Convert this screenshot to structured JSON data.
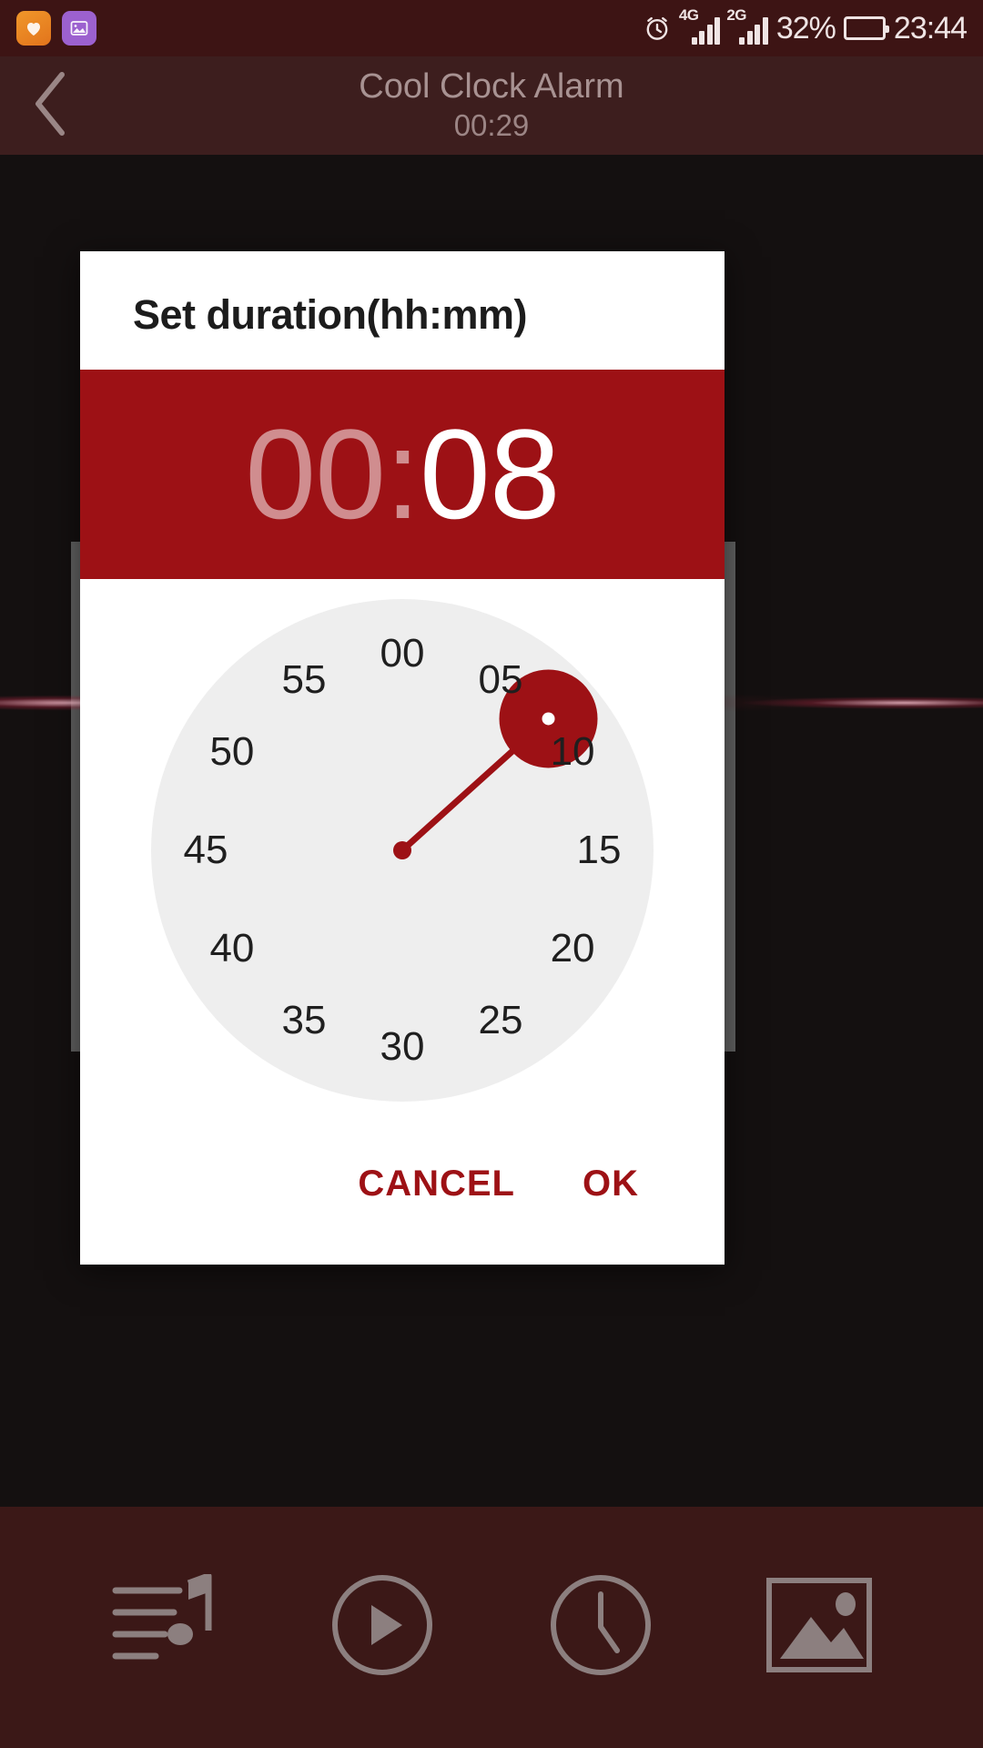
{
  "status_bar": {
    "app_icons": [
      {
        "name": "health-app-icon",
        "color": "#ec8a23"
      },
      {
        "name": "gallery-app-icon",
        "color": "#9c61cf"
      }
    ],
    "alarm_icon": "alarm-clock-icon",
    "networks": [
      {
        "label": "4G",
        "bars": 4
      },
      {
        "label": "2G",
        "bars": 4
      }
    ],
    "battery_percent": "32%",
    "battery_icon": "battery-icon",
    "time": "23:44"
  },
  "title_bar": {
    "back_icon": "back-chevron-icon",
    "title": "Cool Clock Alarm",
    "subtitle": "00:29"
  },
  "dialog": {
    "title": "Set duration(hh:mm)",
    "time": {
      "hours": "00",
      "separator": ":",
      "minutes": "08"
    },
    "clock": {
      "numbers": [
        "00",
        "05",
        "10",
        "15",
        "20",
        "25",
        "30",
        "35",
        "40",
        "45",
        "50",
        "55"
      ],
      "selected_value": "08",
      "selected_angle_deg": 48,
      "accent_color": "#9d1115",
      "face_color": "#eeeeee"
    },
    "actions": {
      "cancel_label": "CANCEL",
      "ok_label": "OK"
    }
  },
  "bottom_nav": {
    "items": [
      {
        "name": "playlist-music-icon"
      },
      {
        "name": "play-circle-icon"
      },
      {
        "name": "clock-icon"
      },
      {
        "name": "image-gallery-icon"
      }
    ]
  }
}
